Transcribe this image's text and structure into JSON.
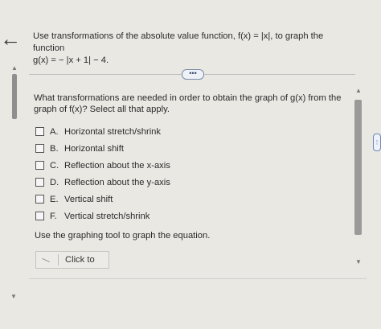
{
  "nav": {
    "back_glyph": "←"
  },
  "question": {
    "line1": "Use transformations of the absolute value function, f(x) = |x|, to graph the function",
    "line2": "g(x) = − |x + 1| − 4."
  },
  "more_button": {
    "label": "•••"
  },
  "subquestion": {
    "text": "What transformations are needed in order to obtain the graph of g(x) from the graph of f(x)? Select all that apply."
  },
  "options": [
    {
      "letter": "A.",
      "label": "Horizontal stretch/shrink"
    },
    {
      "letter": "B.",
      "label": "Horizontal shift"
    },
    {
      "letter": "C.",
      "label": "Reflection about the x-axis"
    },
    {
      "letter": "D.",
      "label": "Reflection about the y-axis"
    },
    {
      "letter": "E.",
      "label": "Vertical shift"
    },
    {
      "letter": "F.",
      "label": "Vertical stretch/shrink"
    }
  ],
  "graphing": {
    "instruction": "Use the graphing tool to graph the equation.",
    "click_label": "Click to"
  },
  "scroll": {
    "up_glyph": "▲",
    "down_glyph": "▼"
  },
  "edge_handle": {
    "label": "⋮"
  }
}
